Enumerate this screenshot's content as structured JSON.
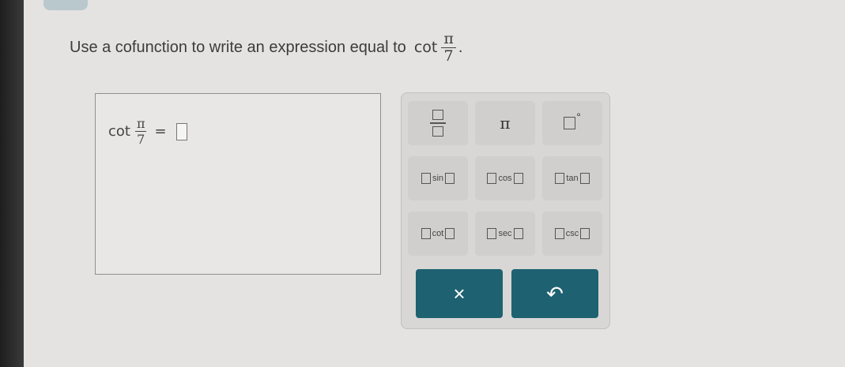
{
  "question": {
    "prompt": "Use a cofunction to write an expression equal to",
    "func": "cot",
    "numerator": "π",
    "denominator": "7",
    "period": "."
  },
  "answer": {
    "func": "cot",
    "numerator": "π",
    "denominator": "7",
    "equals": "="
  },
  "keypad": {
    "pi": "π",
    "degree": "°",
    "trig": [
      "sin",
      "cos",
      "tan",
      "cot",
      "sec",
      "csc"
    ],
    "clear": "×",
    "undo": "↶"
  },
  "colors": {
    "action_button": "#1e6171",
    "background": "#e4e3e1"
  }
}
